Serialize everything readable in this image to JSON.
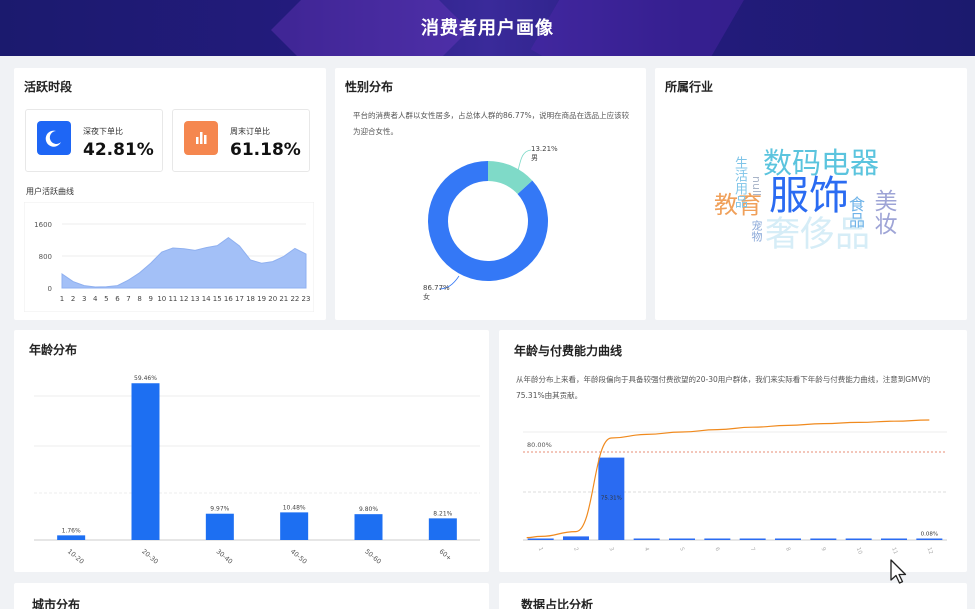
{
  "header": {
    "title": "消费者用户画像"
  },
  "activity": {
    "title": "活跃时段",
    "night": {
      "label": "深夜下单比",
      "value": "42.81%"
    },
    "weekend": {
      "label": "周末订单比",
      "value": "61.18%"
    },
    "curve_label": "用户活跃曲线",
    "chart_data": {
      "type": "area",
      "x": [
        "1",
        "2",
        "3",
        "4",
        "5",
        "6",
        "7",
        "8",
        "9",
        "10",
        "11",
        "12",
        "13",
        "14",
        "15",
        "16",
        "17",
        "18",
        "19",
        "20",
        "21",
        "22",
        "23"
      ],
      "values": [
        350,
        160,
        60,
        25,
        30,
        60,
        200,
        380,
        620,
        900,
        1000,
        980,
        940,
        1010,
        1060,
        1260,
        1050,
        700,
        620,
        660,
        790,
        990,
        850
      ],
      "yticks": [
        "0",
        "800",
        "1600"
      ],
      "ylim": [
        0,
        1700
      ],
      "color": "#a3c0f7"
    }
  },
  "gender": {
    "title": "性别分布",
    "desc": "平台的消费者人群以女性居多，占总体人群的86.77%，说明在商品在选品上应该较为迎合女性。",
    "chart_data": {
      "type": "pie",
      "labels": [
        "女",
        "男"
      ],
      "values": [
        86.77,
        13.21
      ],
      "value_labels": [
        "86.77%",
        "13.21%"
      ],
      "colors": [
        "#3478f6",
        "#7fdac8"
      ]
    }
  },
  "industry": {
    "title": "所属行业",
    "words": [
      {
        "text": "服饰",
        "color": "#2a6bf2"
      },
      {
        "text": "数码电器",
        "color": "#5bc4de"
      },
      {
        "text": "奢侈品",
        "color": "#d6edf7"
      },
      {
        "text": "教育",
        "color": "#f0a05a"
      },
      {
        "text": "美妆",
        "color": "#9ea4d6"
      },
      {
        "text": "食品",
        "color": "#6fb3e8"
      },
      {
        "text": "生活用品",
        "color": "#7ec4e8"
      },
      {
        "text": "null",
        "color": "#a8b4c8"
      },
      {
        "text": "宠物",
        "color": "#8aa8d8"
      }
    ]
  },
  "age": {
    "title": "年龄分布",
    "chart_data": {
      "type": "bar",
      "categories": [
        "10-20",
        "20-30",
        "30-40",
        "40-50",
        "50-60",
        "60+"
      ],
      "values": [
        1.76,
        59.46,
        9.97,
        10.48,
        9.8,
        8.21
      ],
      "value_labels": [
        "1.76%",
        "59.46%",
        "9.97%",
        "10.48%",
        "9.80%",
        "8.21%"
      ],
      "ylim": [
        0,
        66
      ],
      "color": "#1d6ff2"
    }
  },
  "age_pay": {
    "title": "年龄与付费能力曲线",
    "desc": "从年龄分布上来看，年龄段偏向于具备较强付费欲望的20-30用户群体，我们来实际看下年龄与付费能力曲线，注意到GMV的75.31%由其贡献。",
    "markline_label": "80.00%",
    "chart_data": {
      "type": "bar",
      "categories": [
        "1",
        "2",
        "3",
        "4",
        "5",
        "6",
        "7",
        "8",
        "9",
        "10",
        "11",
        "12"
      ],
      "values": [
        0.5,
        3.0,
        37.0,
        1.0,
        0.8,
        0.9,
        1.0,
        1.2,
        1.1,
        0.9,
        1.0,
        0.6
      ],
      "value_labels": {
        "2": "75.31%",
        "11": "0.08%"
      },
      "cumulative": [
        3,
        7,
        85,
        88,
        90,
        92,
        94,
        95.5,
        97,
        98,
        99,
        100
      ],
      "ylim": [
        0,
        105
      ],
      "markline": 80,
      "bar_color": "#2a6bf2",
      "line_color": "#f08a1e"
    }
  },
  "city": {
    "title": "城市分布"
  },
  "data_share": {
    "title": "数据占比分析"
  }
}
